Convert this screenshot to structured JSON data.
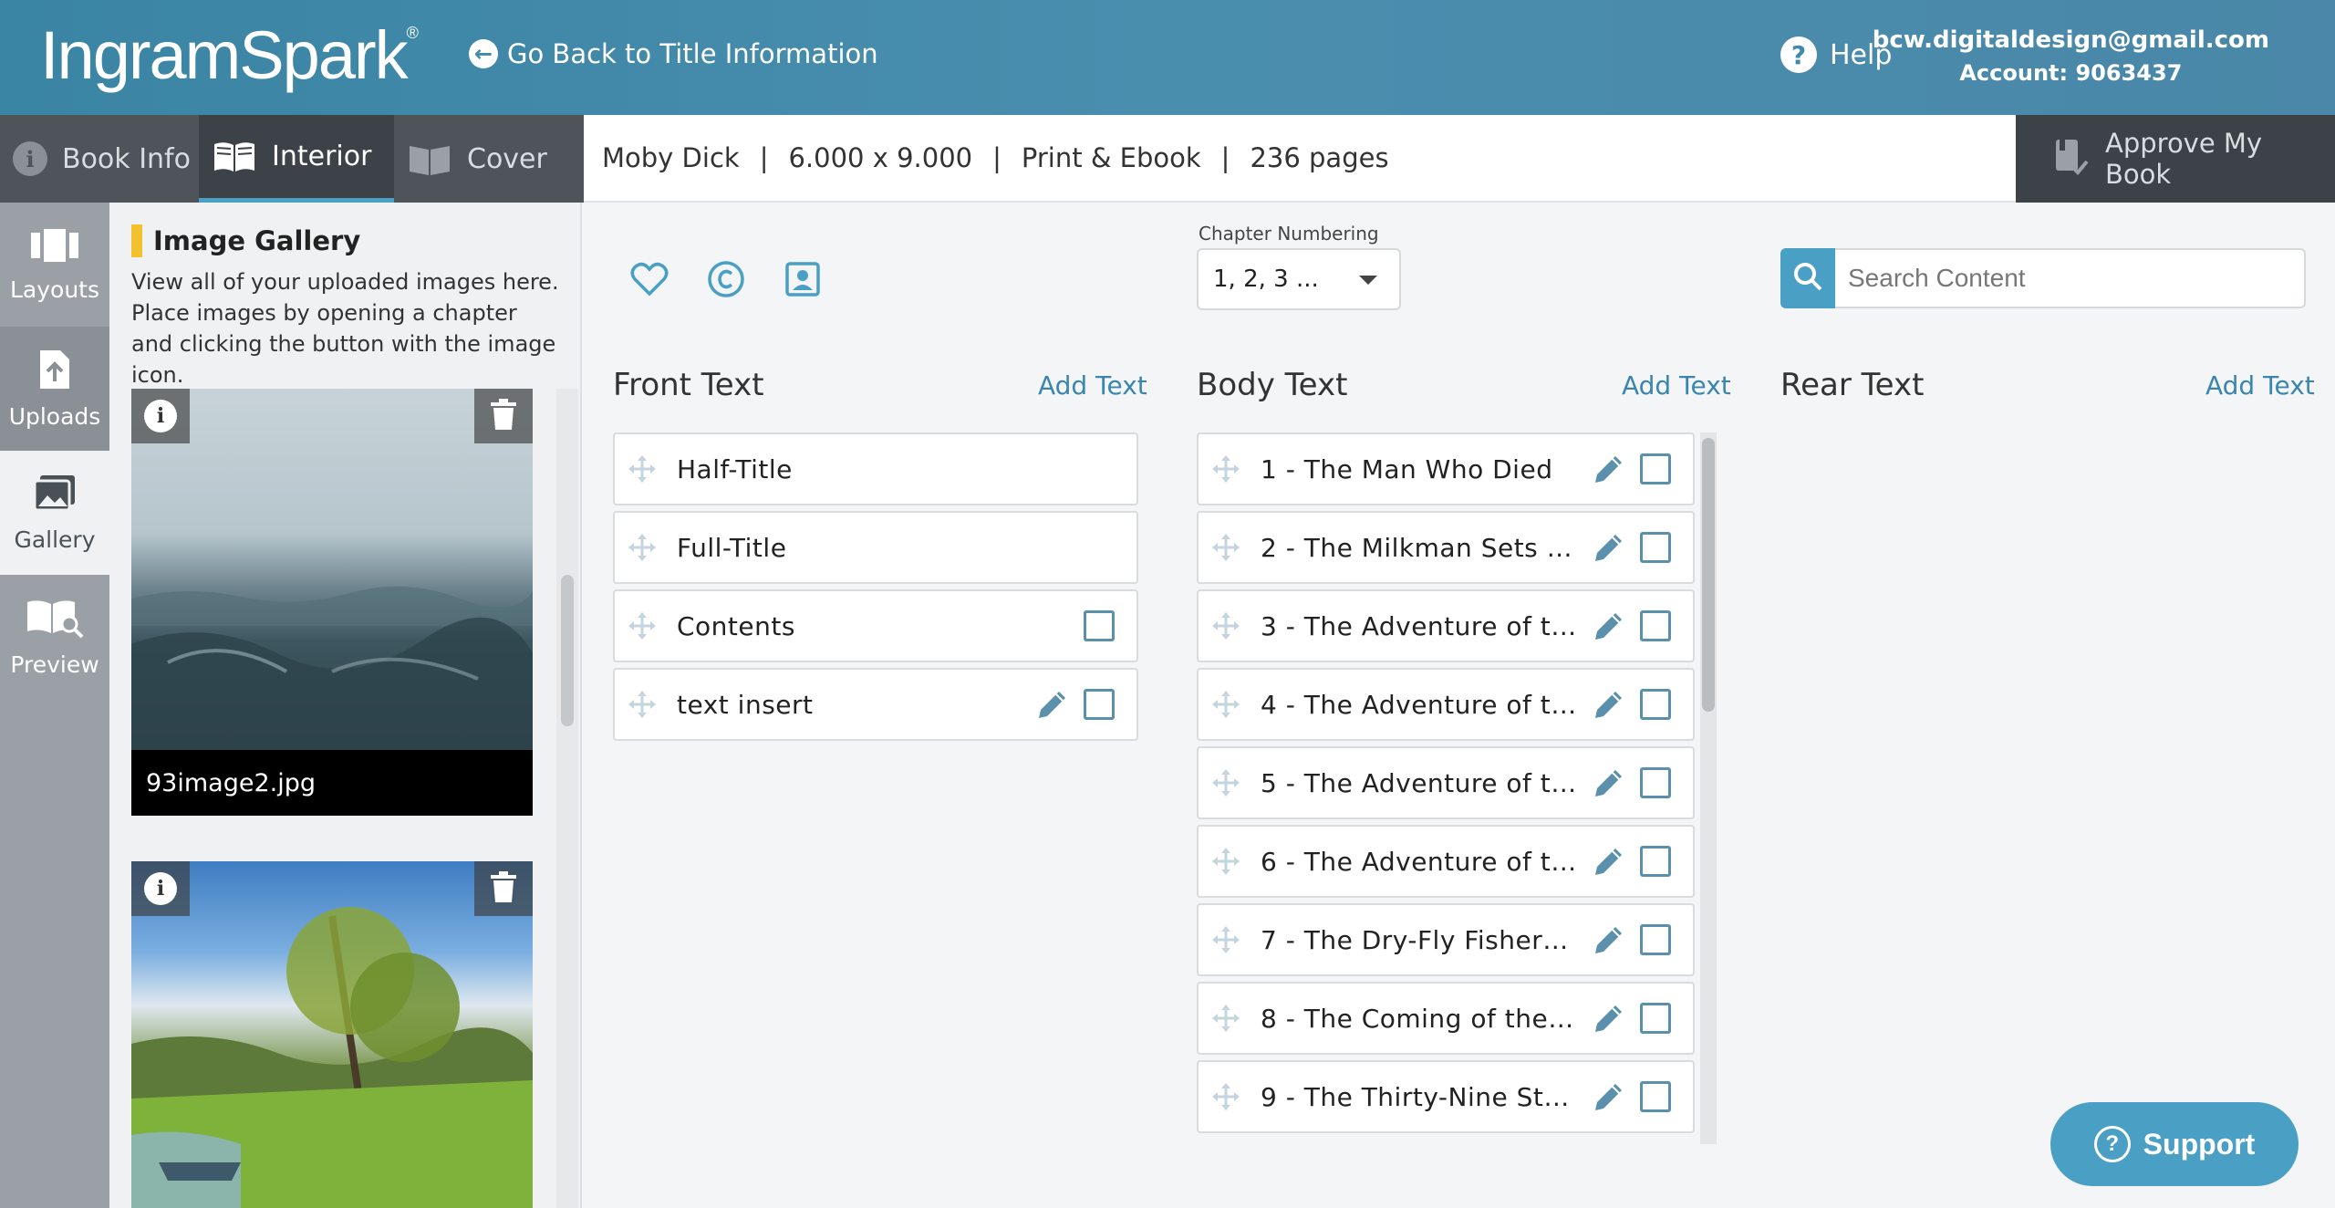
{
  "header": {
    "logo": "IngramSpark",
    "logo_mark": "®",
    "back_link": "Go Back to Title Information",
    "help": "Help",
    "email": "bcw.digitaldesign@gmail.com",
    "account": "Account: 9063437"
  },
  "tabs": [
    {
      "label": "Book Info",
      "icon": "info-icon"
    },
    {
      "label": "Interior",
      "icon": "open-book-icon",
      "active": true
    },
    {
      "label": "Cover",
      "icon": "book-cover-icon"
    }
  ],
  "book": {
    "title": "Moby Dick",
    "trim": "6.000 x 9.000",
    "format": "Print & Ebook",
    "pages": "236 pages"
  },
  "approve_label": "Approve My Book",
  "rail": [
    {
      "label": "Layouts",
      "icon": "layouts-icon"
    },
    {
      "label": "Uploads",
      "icon": "upload-icon"
    },
    {
      "label": "Gallery",
      "icon": "gallery-icon",
      "active": true
    },
    {
      "label": "Preview",
      "icon": "preview-icon"
    }
  ],
  "gallery": {
    "title": "Image Gallery",
    "description": "View all of your uploaded images here. Place images by opening a chapter and clicking the button with the image icon.",
    "images": [
      {
        "caption": "93image2.jpg"
      }
    ]
  },
  "chapter_numbering": {
    "label": "Chapter Numbering",
    "value": "1, 2, 3 ..."
  },
  "search": {
    "placeholder": "Search Content"
  },
  "front_text": {
    "heading": "Front Text",
    "add": "Add Text",
    "items": [
      "Half-Title",
      "Full-Title",
      "Contents",
      "text insert"
    ]
  },
  "body_text": {
    "heading": "Body Text",
    "add": "Add Text",
    "items": [
      "1 - The Man Who Died",
      "2 - The Milkman Sets …",
      "3 - The Adventure of t…",
      "4 - The Adventure of t…",
      "5 - The Adventure of t…",
      "6 - The Adventure of t…",
      "7 - The Dry-Fly Fisher…",
      "8 - The Coming of the…",
      "9 - The Thirty-Nine St…"
    ]
  },
  "rear_text": {
    "heading": "Rear Text",
    "add": "Add Text"
  },
  "support_label": "Support",
  "colors": {
    "accent": "#4a9fc5",
    "header": "#3f89aa",
    "tab_dark": "#3c4247",
    "highlight": "#f2c12e"
  }
}
